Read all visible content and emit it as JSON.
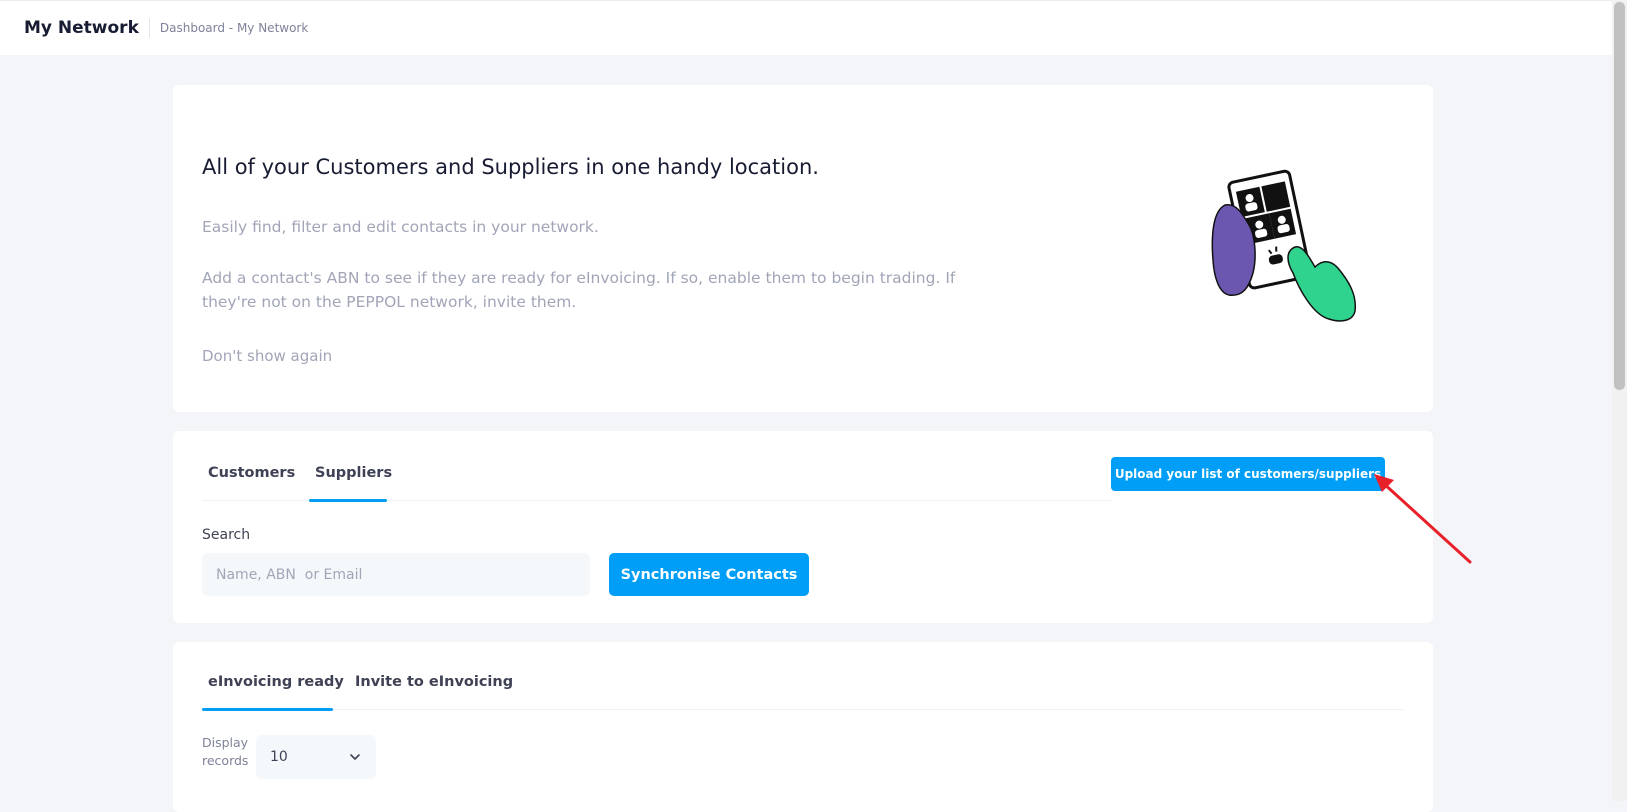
{
  "header": {
    "title": "My Network",
    "breadcrumb": "Dashboard - My Network"
  },
  "hero": {
    "title": "All of your Customers and Suppliers in one handy location.",
    "paragraph1": "Easily find, filter and edit contacts in your network.",
    "paragraph2": "Add a contact's ABN to see if they are ready for eInvoicing. If so, enable them to begin trading. If they're not on the PEPPOL network, invite them.",
    "dont_show": "Don't show again"
  },
  "network_tabs": {
    "items": [
      {
        "label": "Customers",
        "active": false
      },
      {
        "label": "Suppliers",
        "active": true
      }
    ]
  },
  "upload_button": "Upload your list of customers/suppliers",
  "search": {
    "label": "Search",
    "placeholder": "Name, ABN  or Email",
    "value": ""
  },
  "sync_button": "Synchronise Contacts",
  "status_tabs": {
    "items": [
      {
        "label": "eInvoicing ready",
        "active": true
      },
      {
        "label": "Invite to eInvoicing",
        "active": false
      }
    ]
  },
  "display": {
    "label": "Display records",
    "value": "10"
  },
  "colors": {
    "accent": "#009ef7",
    "annotation_arrow": "#e8202a",
    "hand_left": "#6b57b0",
    "hand_right": "#2fd38e"
  },
  "icons": {
    "select_chevron": "chevron-down-icon",
    "illustration": "phone-contacts-illustration"
  }
}
